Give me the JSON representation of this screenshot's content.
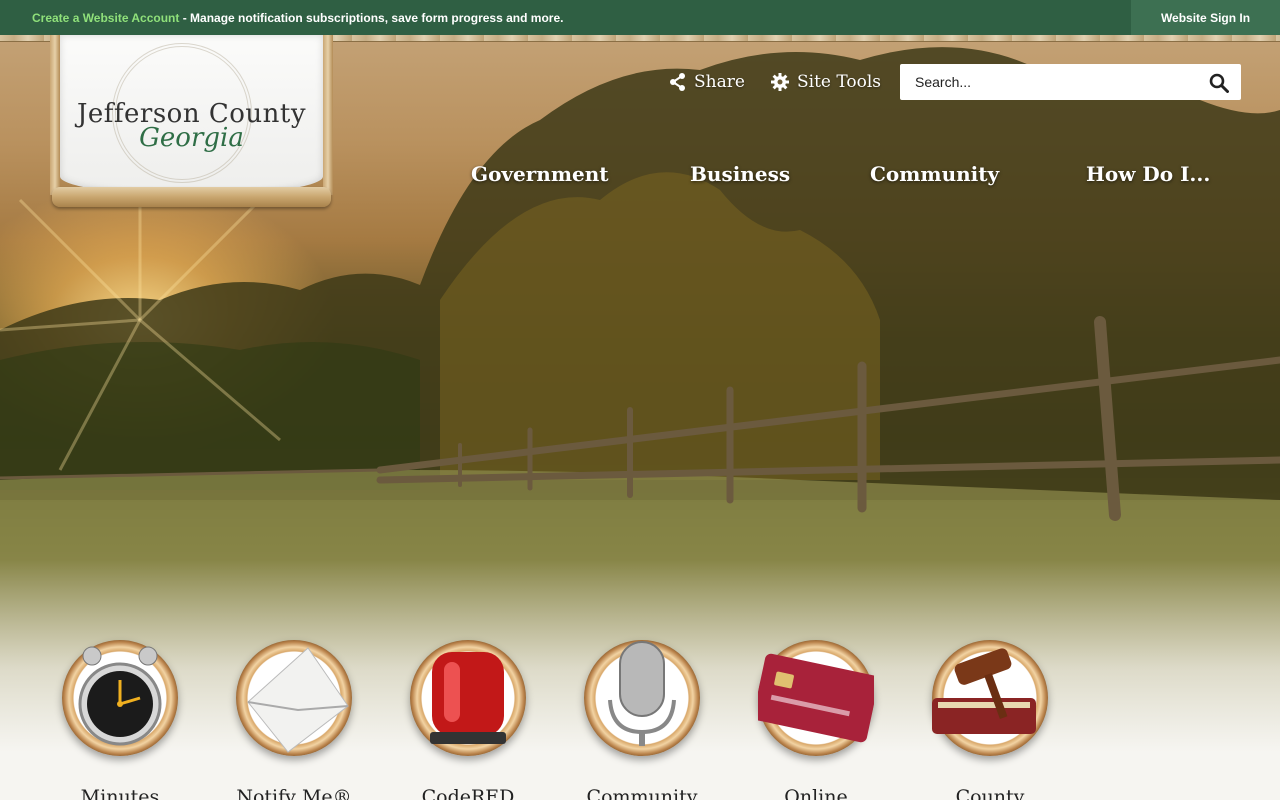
{
  "notification_bar": {
    "link": "Create a Website Account",
    "text": " - Manage notification subscriptions, save form progress and more.",
    "sign_in": "Website Sign In"
  },
  "logo": {
    "line1": "Jefferson County",
    "line2": "Georgia"
  },
  "tools": {
    "share": "Share",
    "site_tools": "Site Tools"
  },
  "search": {
    "placeholder": "Search..."
  },
  "nav": {
    "items": [
      {
        "label": "Government"
      },
      {
        "label": "Business"
      },
      {
        "label": "Community"
      },
      {
        "label": "How Do I..."
      }
    ]
  },
  "quick_links": [
    {
      "label": "Minutes",
      "icon": "alarm-clock-icon"
    },
    {
      "label": "Notify Me®",
      "icon": "envelope-icon"
    },
    {
      "label": "CodeRED",
      "icon": "siren-icon"
    },
    {
      "label": "Community",
      "icon": "microphone-icon"
    },
    {
      "label": "Online",
      "icon": "credit-card-icon"
    },
    {
      "label": "County",
      "icon": "gavel-icon"
    }
  ],
  "colors": {
    "topbar": "#2f5f43",
    "signin": "#3d7052",
    "link": "#8fe07a"
  }
}
